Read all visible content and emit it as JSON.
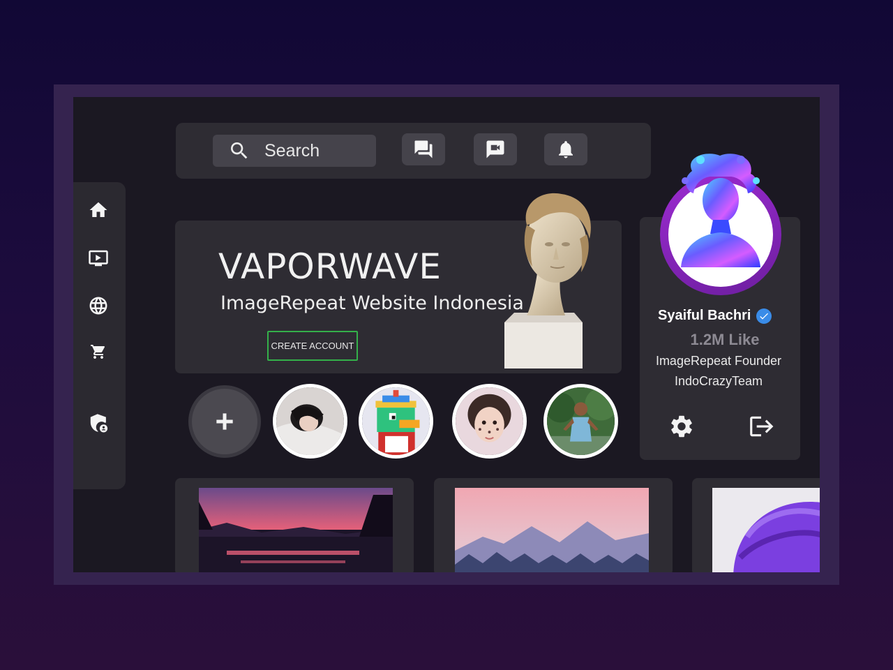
{
  "search": {
    "placeholder": "Search"
  },
  "hero": {
    "title": "VAPORWAVE",
    "subtitle": "ImageRepeat Website Indonesia",
    "cta_label": "CREATE ACCOUNT"
  },
  "profile": {
    "name": "Syaiful Bachri",
    "likes": "1.2M Like",
    "role": "ImageRepeat Founder",
    "team": "IndoCrazyTeam",
    "verified": true
  },
  "sidebar": {
    "items": [
      {
        "icon": "home-icon"
      },
      {
        "icon": "tv-icon"
      },
      {
        "icon": "globe-icon"
      },
      {
        "icon": "cart-icon"
      },
      {
        "icon": "shield-user-icon"
      }
    ]
  },
  "topbar": {
    "buttons": [
      {
        "icon": "chat-icon"
      },
      {
        "icon": "video-chat-icon"
      },
      {
        "icon": "bell-icon"
      }
    ]
  },
  "stories": [
    "add-story",
    "story-1",
    "story-2",
    "story-3",
    "story-4"
  ],
  "colors": {
    "background": "#1b1822",
    "panel": "#2e2c33",
    "accent_green": "#34b04a",
    "accent_purple": "#9c2bd0",
    "verified_blue": "#3a8ce8"
  }
}
